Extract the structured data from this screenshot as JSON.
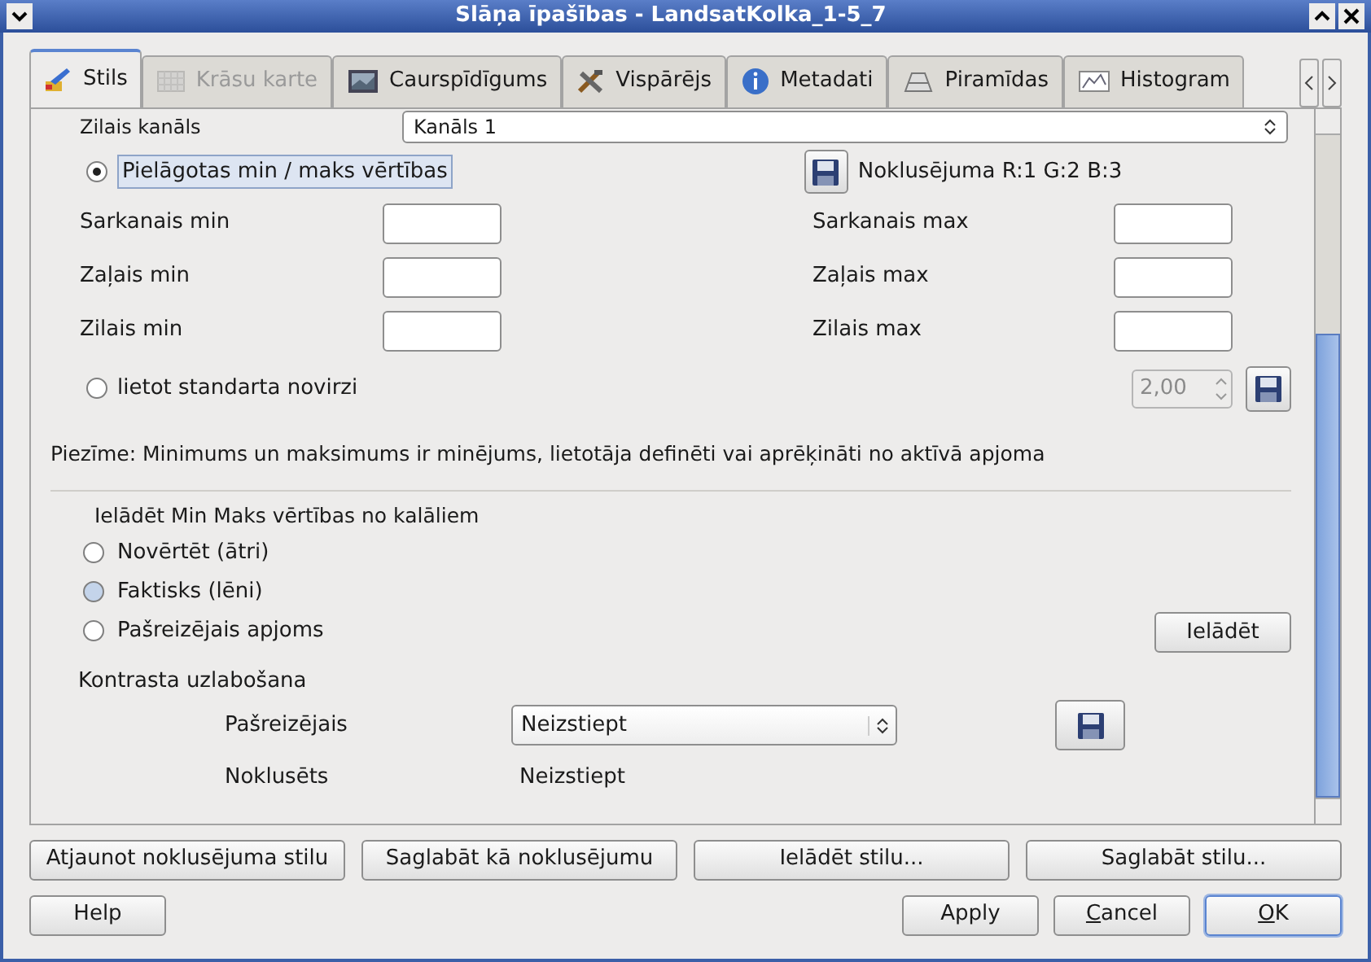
{
  "window": {
    "title": "Slāņa īpašības - LandsatKolka_1-5_7"
  },
  "tabs": [
    {
      "label": "Stils",
      "kind": "brush",
      "selected": true,
      "disabled": false
    },
    {
      "label": "Krāsu karte",
      "kind": "grid",
      "selected": false,
      "disabled": true
    },
    {
      "label": "Caurspīdīgums",
      "kind": "monitor",
      "selected": false,
      "disabled": false
    },
    {
      "label": "Vispārējs",
      "kind": "tools",
      "selected": false,
      "disabled": false
    },
    {
      "label": "Metadati",
      "kind": "info",
      "selected": false,
      "disabled": false
    },
    {
      "label": "Piramīdas",
      "kind": "pyramid",
      "selected": false,
      "disabled": false
    },
    {
      "label": "Histogram",
      "kind": "chart",
      "selected": false,
      "disabled": false
    }
  ],
  "band": {
    "label": "Zilais kanāls",
    "value": "Kanāls 1"
  },
  "custom_minmax": {
    "label": "Pielāgotas min / maks vērtības",
    "selected": true,
    "default_label": "Noklusējuma R:1 G:2 B:3"
  },
  "minmax_fields": [
    {
      "min_label": "Sarkanais min",
      "max_label": "Sarkanais max"
    },
    {
      "min_label": "Zaļais min",
      "max_label": "Zaļais max"
    },
    {
      "min_label": "Zilais min",
      "max_label": "Zilais max"
    }
  ],
  "stddev": {
    "label": "lietot standarta novirzi",
    "selected": false,
    "value": "2,00",
    "disabled": true
  },
  "note": "Piezīme: Minimums un maksimums ir minējums, lietotāja definēti vai aprēķināti no aktīvā apjoma",
  "load": {
    "title": "Ielādēt Min Maks vērtības no kalāliem",
    "options": [
      {
        "label": "Novērtēt (ātri)",
        "selected": false,
        "hovered": false
      },
      {
        "label": "Faktisks (lēni)",
        "selected": false,
        "hovered": true
      },
      {
        "label": "Pašreizējais apjoms",
        "selected": false,
        "hovered": false
      }
    ],
    "button": "Ielādēt"
  },
  "contrast": {
    "title": "Kontrasta uzlabošana",
    "current_label": "Pašreizējais",
    "current_value": "Neizstiept",
    "default_label": "Noklusēts",
    "default_value": "Neizstiept"
  },
  "style_buttons": [
    "Atjaunot noklusējuma stilu",
    "Saglabāt kā noklusējumu",
    "Ielādēt stilu...",
    "Saglabāt stilu..."
  ],
  "dialog_buttons": [
    {
      "label": "Help",
      "mnemonic": false,
      "default": false
    },
    {
      "label": "Apply",
      "mnemonic": false,
      "default": false
    },
    {
      "label": "Cancel",
      "mnemonic": true,
      "default": false
    },
    {
      "label": "OK",
      "mnemonic": true,
      "default": true
    }
  ]
}
